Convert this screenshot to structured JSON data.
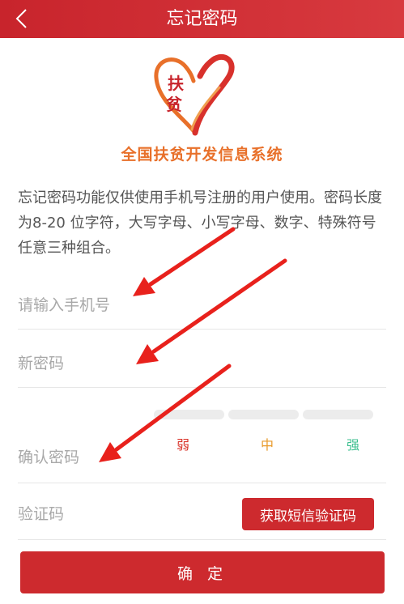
{
  "header": {
    "title": "忘记密码"
  },
  "logo": {
    "text_top": "扶",
    "text_bottom": "贫"
  },
  "slogan": "全国扶贫开发信息系统",
  "description": "忘记密码功能仅供使用手机号注册的用户使用。密码长度为8-20 位字符，大写字母、小写字母、数字、特殊符号任意三种组合。",
  "form": {
    "phone_placeholder": "请输入手机号",
    "new_password_placeholder": "新密码",
    "confirm_password_placeholder": "确认密码",
    "code_placeholder": "验证码",
    "sms_button": "获取短信验证码"
  },
  "strength": {
    "weak": "弱",
    "medium": "中",
    "strong": "强",
    "colors": {
      "weak": "#d9342b",
      "medium": "#e89a2a",
      "strong": "#3cbf8f"
    }
  },
  "submit_label": "确 定",
  "colors": {
    "primary": "#cd2a2e",
    "annotation": "#e8211c"
  }
}
